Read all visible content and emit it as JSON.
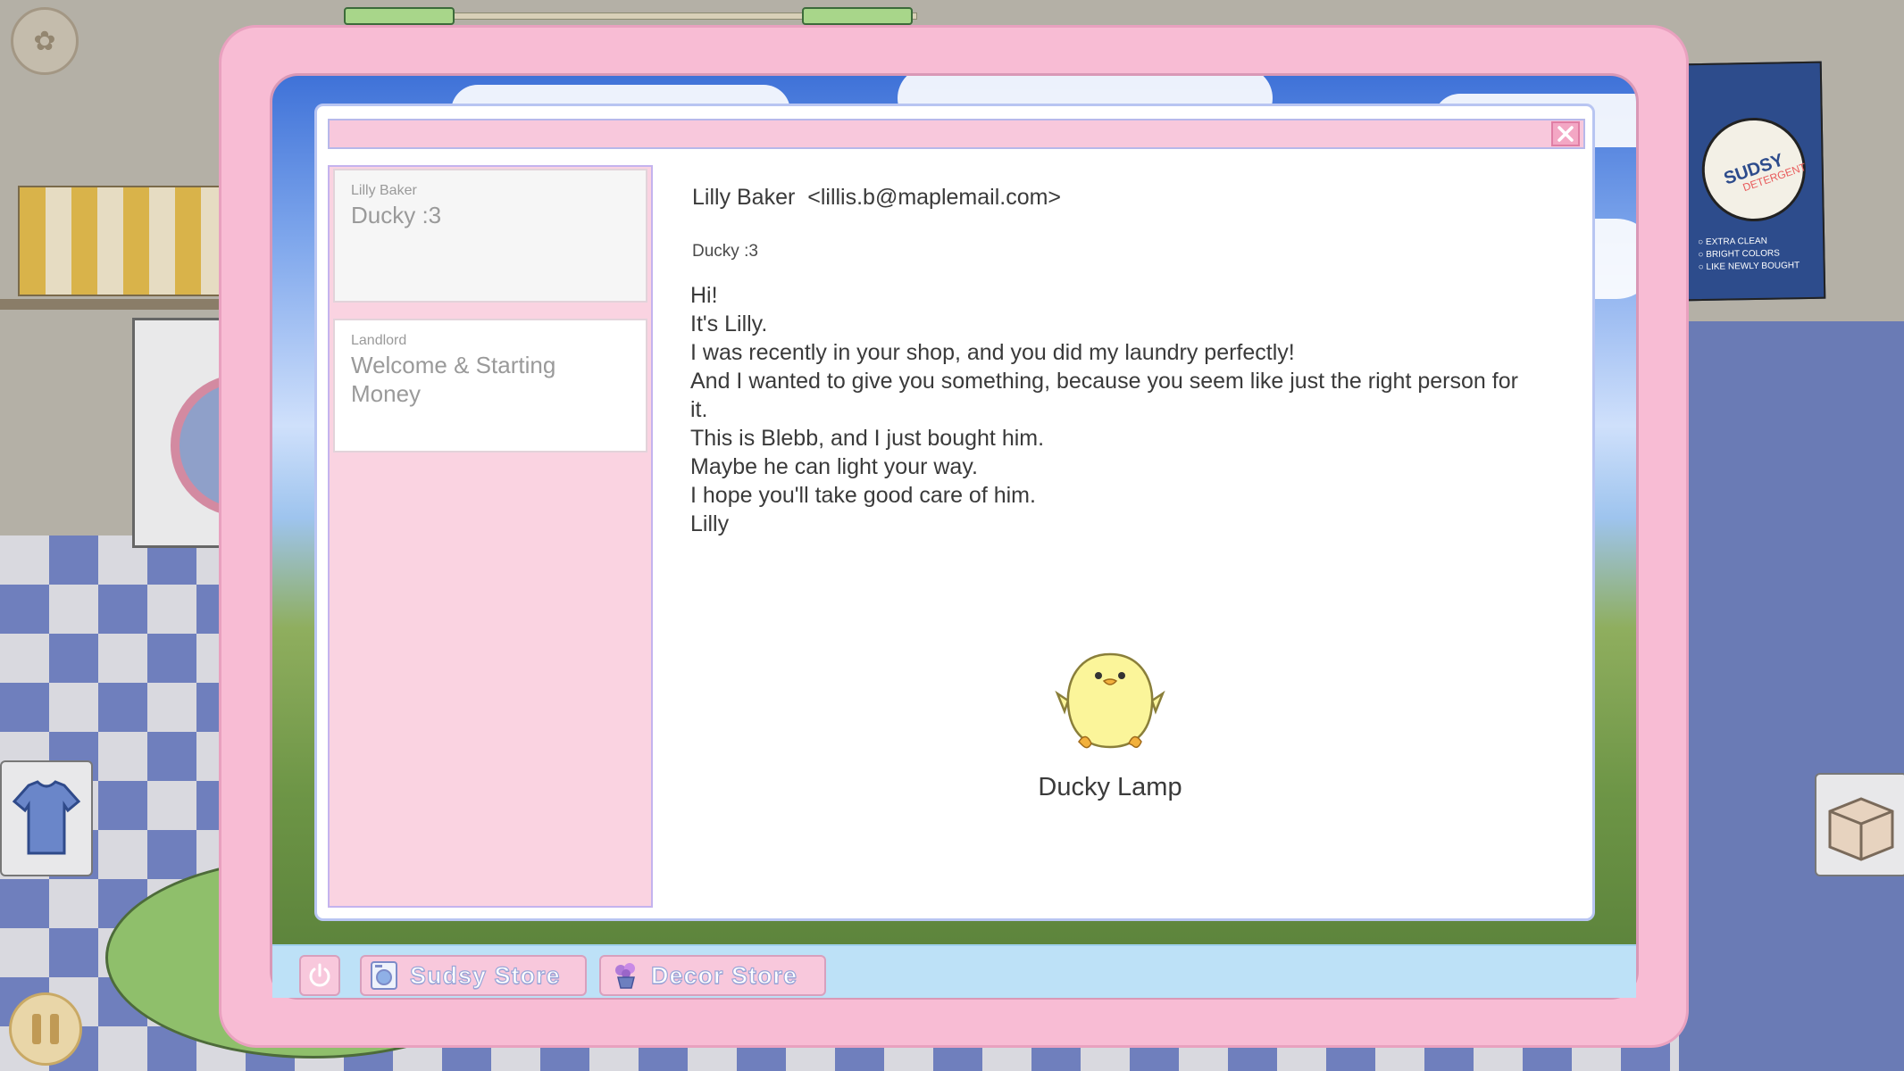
{
  "mail_list": [
    {
      "sender": "Lilly Baker",
      "subject": "Ducky :3",
      "selected": true
    },
    {
      "sender": "Landlord",
      "subject": "Welcome & Starting Money",
      "selected": false
    }
  ],
  "message": {
    "from_name": "Lilly Baker",
    "from_email": "<lillis.b@maplemail.com>",
    "subject": "Ducky :3",
    "lines": [
      "Hi!",
      "It's Lilly.",
      "I was recently in your shop, and you did my laundry perfectly!",
      "And I wanted to give you something, because you seem like just the right person for it.",
      "This is Blebb, and I just bought him.",
      "Maybe he can light your way.",
      "I hope you'll take good care of him.",
      "Lilly"
    ],
    "attachment": {
      "label": "Ducky Lamp",
      "icon": "duck-icon"
    }
  },
  "taskbar": {
    "power_icon": "power-icon",
    "sudsy_store": "Sudsy Store",
    "decor_store": "Decor Store"
  },
  "background": {
    "poster_text": "SUDSY",
    "poster_lines": [
      "○ EXTRA CLEAN",
      "○ BRIGHT COLORS",
      "○ LIKE NEWLY BOUGHT"
    ],
    "poster_sub": "DETERGENT"
  },
  "colors": {
    "tablet_frame": "#f8bcd4",
    "window_border": "#b8c5f2",
    "title_bar": "#f8c8dc",
    "taskbar": "#bde1f7",
    "duck": "#fbf59a"
  }
}
